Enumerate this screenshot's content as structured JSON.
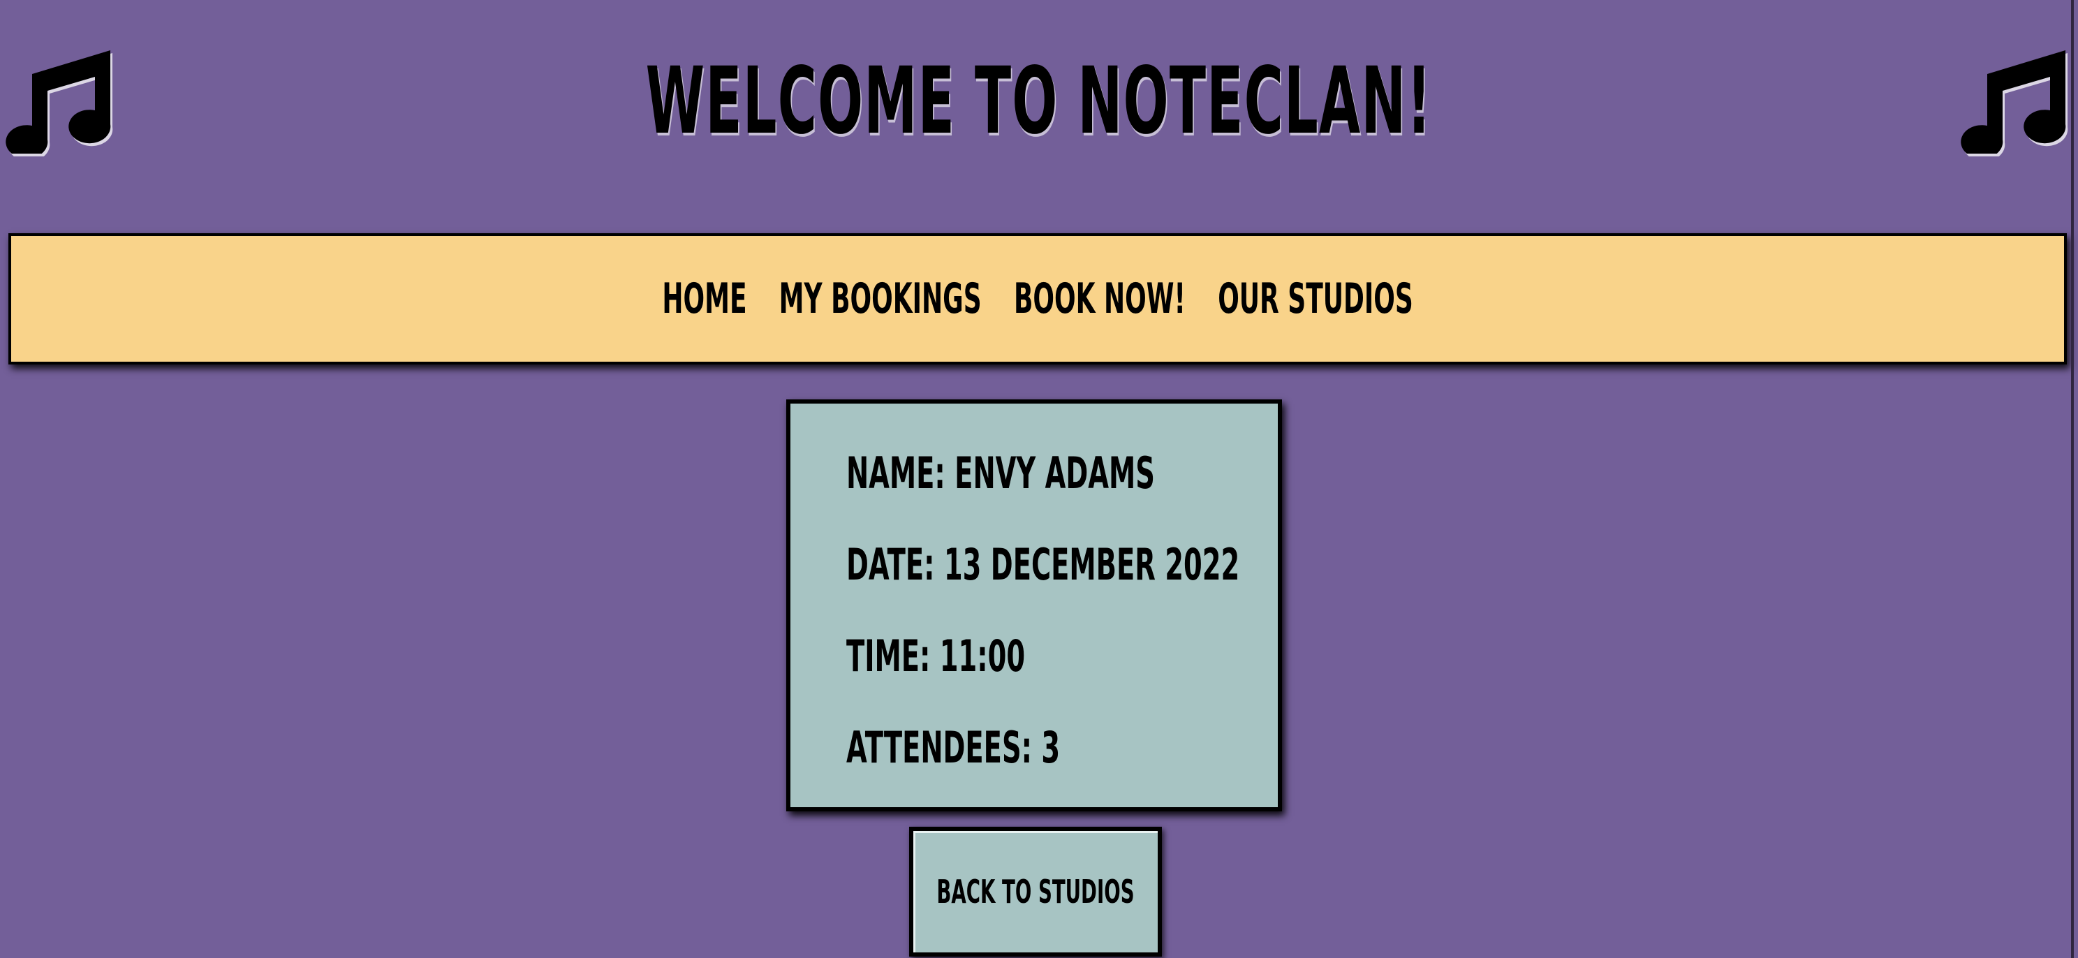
{
  "header": {
    "title": "Welcome to NoteClan!",
    "left_icon": "music-note-icon",
    "right_icon": "music-note-icon"
  },
  "nav": {
    "items": [
      {
        "label": "Home"
      },
      {
        "label": "My Bookings"
      },
      {
        "label": "Book Now!"
      },
      {
        "label": "Our Studios"
      }
    ]
  },
  "booking": {
    "name": "Name: Envy Adams",
    "date": "Date: 13 December 2022",
    "time": "Time: 11:00",
    "attendees": "Attendees: 3"
  },
  "actions": {
    "back_label": "Back to studios"
  },
  "colors": {
    "background": "#735f99",
    "nav_bg": "#f9d38a",
    "card_bg": "#a7c4c3",
    "text": "#000000"
  }
}
